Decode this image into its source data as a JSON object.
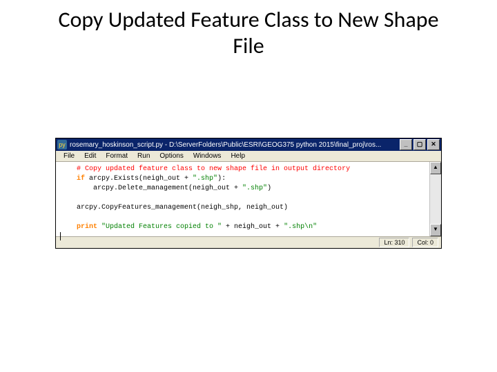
{
  "slide": {
    "title": "Copy Updated Feature Class to New Shape File"
  },
  "window": {
    "icon_label": "py",
    "title": "rosemary_hoskinson_script.py - D:\\ServerFolders\\Public\\ESRI\\GEOG375 python 2015\\final_proj\\ros...",
    "buttons": {
      "min": "_",
      "max": "▢",
      "close": "✕"
    }
  },
  "menu": {
    "file": "File",
    "edit": "Edit",
    "format": "Format",
    "run": "Run",
    "options": "Options",
    "windows": "Windows",
    "help": "Help"
  },
  "code": {
    "l1_comment": "# Copy updated feature class to new shape file in output directory",
    "l2_kw": "if",
    "l2_rest": " arcpy.Exists(neigh_out + ",
    "l2_str": "\".shp\"",
    "l2_end": "):",
    "l3": "    arcpy.Delete_management(neigh_out + ",
    "l3_str": "\".shp\"",
    "l3_end": ")",
    "l5": "arcpy.CopyFeatures_management(neigh_shp, neigh_out)",
    "l7_kw": "print",
    "l7_str1": " \"Updated Features copied to \"",
    "l7_mid": " + neigh_out + ",
    "l7_str2": "\".shp\\n\""
  },
  "status": {
    "lncol": "Ln: 310",
    "col": "Col: 0"
  },
  "scroll": {
    "up": "▲",
    "down": "▼"
  }
}
